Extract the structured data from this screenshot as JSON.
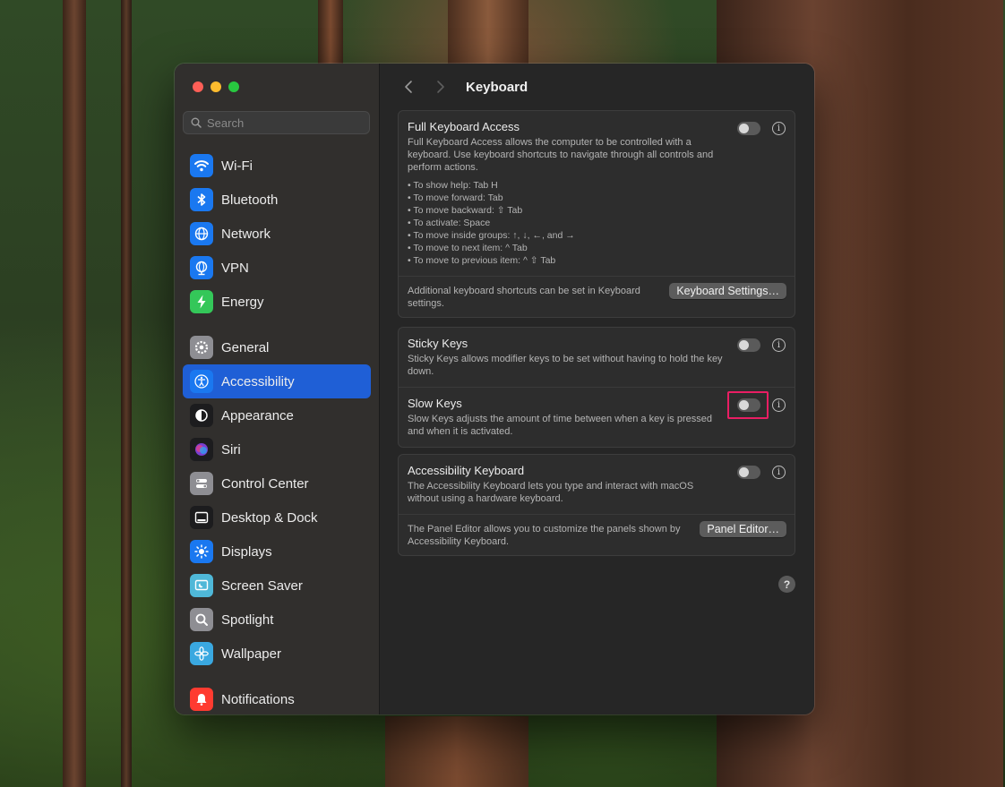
{
  "sidebar": {
    "search_placeholder": "Search",
    "items": [
      {
        "label": "Wi-Fi",
        "icon": "wifi-icon",
        "color": "#1a78f0"
      },
      {
        "label": "Bluetooth",
        "icon": "bluetooth-icon",
        "color": "#1a78f0"
      },
      {
        "label": "Network",
        "icon": "globe-icon",
        "color": "#1a78f0"
      },
      {
        "label": "VPN",
        "icon": "vpn-globe-icon",
        "color": "#1a78f0"
      },
      {
        "label": "Energy",
        "icon": "bolt-icon",
        "color": "#34c759"
      },
      {
        "label": "General",
        "icon": "gear-icon",
        "color": "#8e8e93"
      },
      {
        "label": "Accessibility",
        "icon": "accessibility-icon",
        "color": "#1a78f0"
      },
      {
        "label": "Appearance",
        "icon": "appearance-icon",
        "color": "#1c1c1e"
      },
      {
        "label": "Siri",
        "icon": "siri-icon",
        "color": "#1c1c1e"
      },
      {
        "label": "Control Center",
        "icon": "control-center-icon",
        "color": "#8e8e93"
      },
      {
        "label": "Desktop & Dock",
        "icon": "dock-icon",
        "color": "#1c1c1e"
      },
      {
        "label": "Displays",
        "icon": "sun-icon",
        "color": "#1a78f0"
      },
      {
        "label": "Screen Saver",
        "icon": "screen-saver-icon",
        "color": "#4fb8d8"
      },
      {
        "label": "Spotlight",
        "icon": "spotlight-icon",
        "color": "#8e8e93"
      },
      {
        "label": "Wallpaper",
        "icon": "wallpaper-icon",
        "color": "#3aa8e0"
      },
      {
        "label": "Notifications",
        "icon": "bell-icon",
        "color": "#ff3b30"
      }
    ]
  },
  "header": {
    "title": "Keyboard"
  },
  "full_keyboard_access": {
    "title": "Full Keyboard Access",
    "desc": "Full Keyboard Access allows the computer to be controlled with a keyboard. Use keyboard shortcuts to navigate through all controls and perform actions.",
    "bullets": [
      "To show help: Tab H",
      "To move forward: Tab",
      "To move backward: ⇧ Tab",
      "To activate: Space",
      "To move inside groups: ↑, ↓, ←, and →",
      "To move to next item: ^ Tab",
      "To move to previous item: ^ ⇧ Tab"
    ],
    "footer": "Additional keyboard shortcuts can be set in Keyboard settings.",
    "button": "Keyboard Settings…",
    "enabled": false
  },
  "sticky_keys": {
    "title": "Sticky Keys",
    "desc": "Sticky Keys allows modifier keys to be set without having to hold the key down.",
    "enabled": false
  },
  "slow_keys": {
    "title": "Slow Keys",
    "desc": "Slow Keys adjusts the amount of time between when a key is pressed and when it is activated.",
    "enabled": false
  },
  "accessibility_keyboard": {
    "title": "Accessibility Keyboard",
    "desc": "The Accessibility Keyboard lets you type and interact with macOS without using a hardware keyboard.",
    "footer": "The Panel Editor allows you to customize the panels shown by Accessibility Keyboard.",
    "button": "Panel Editor…",
    "enabled": false
  },
  "info_glyph": "i",
  "help_glyph": "?",
  "colors": {
    "accent": "#1f5fd6",
    "highlight": "#e91e63"
  }
}
